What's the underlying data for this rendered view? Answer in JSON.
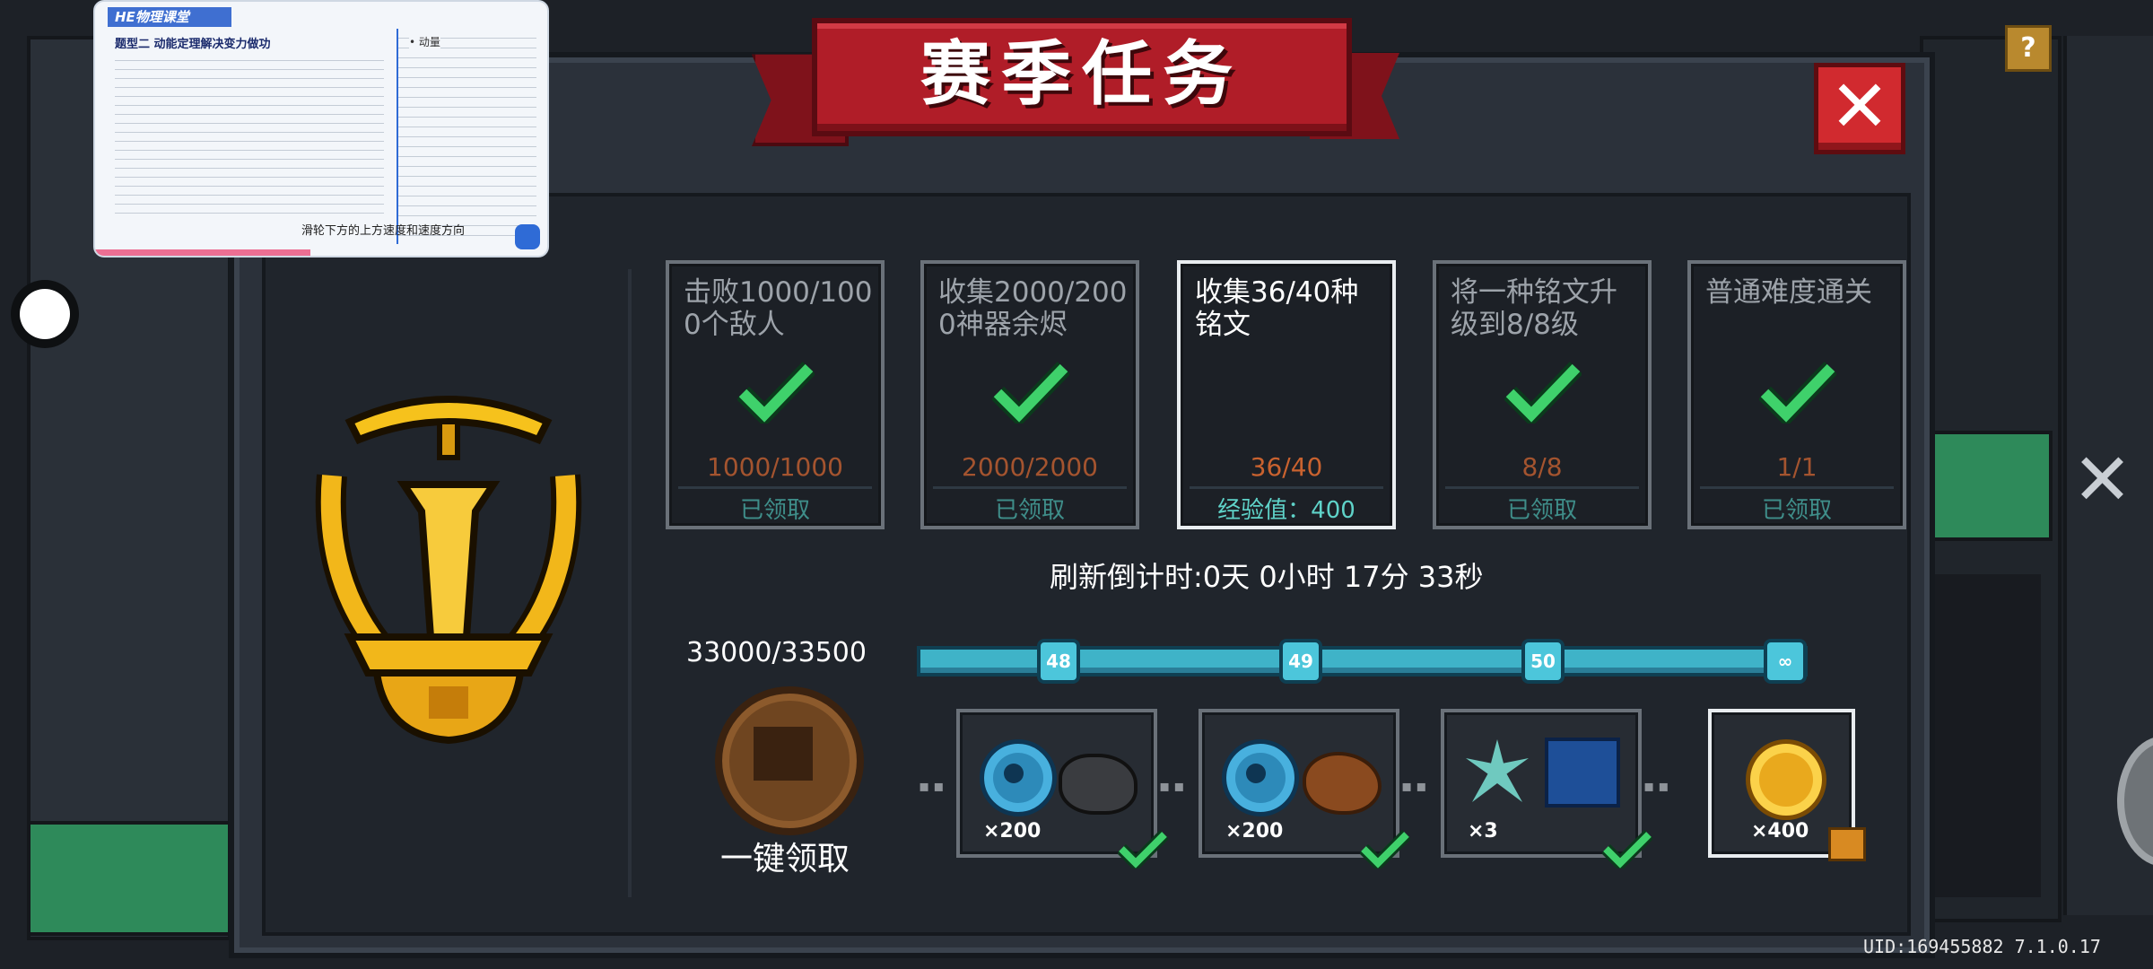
{
  "title": "赛季任务",
  "close_label": "✕",
  "help_label": "?",
  "background_close_label": "✕",
  "uid": "UID:169455882 7.1.0.17",
  "tasks": [
    {
      "title": "击败1000/1000个敌人",
      "progress": "1000/1000",
      "status": "已领取",
      "completed": true
    },
    {
      "title": "收集2000/2000神器余烬",
      "progress": "2000/2000",
      "status": "已领取",
      "completed": true
    },
    {
      "title": "收集36/40种铭文",
      "progress": "36/40",
      "status": "经验值：400",
      "completed": false
    },
    {
      "title": "将一种铭文升级到8/8级",
      "progress": "8/8",
      "status": "已领取",
      "completed": true
    },
    {
      "title": "普通难度通关",
      "progress": "1/1",
      "status": "已领取",
      "completed": true
    }
  ],
  "countdown": "刷新倒计时:0天 0小时 17分 33秒",
  "season_xp": "33000/33500",
  "levels": [
    "48",
    "49",
    "50",
    "∞"
  ],
  "claim_all_label": "一键领取",
  "rewards": [
    {
      "count": "×200",
      "items": [
        "blue-gem-icon",
        "ore-icon"
      ],
      "claimed": true
    },
    {
      "count": "×200",
      "items": [
        "blue-gem-icon",
        "meat-icon"
      ],
      "claimed": true
    },
    {
      "count": "×3",
      "items": [
        "crystal-icon",
        "blueprint-icon"
      ],
      "claimed": true
    },
    {
      "count": "×400",
      "items": [
        "gold-coin-icon"
      ],
      "claimed": false,
      "locked": true
    }
  ],
  "overlay": {
    "header": "HE物理课堂",
    "heading": "题型二 动能定理解决变力做功",
    "side_heading": "• 动量",
    "caption": "滑轮下方的上方速度和速度方向"
  },
  "colors": {
    "banner_red": "#b01d28",
    "check_green": "#3fd16b",
    "progress_orange": "#a4542f",
    "status_teal": "#3f8e8a",
    "track_blue": "#3fb3c8"
  }
}
